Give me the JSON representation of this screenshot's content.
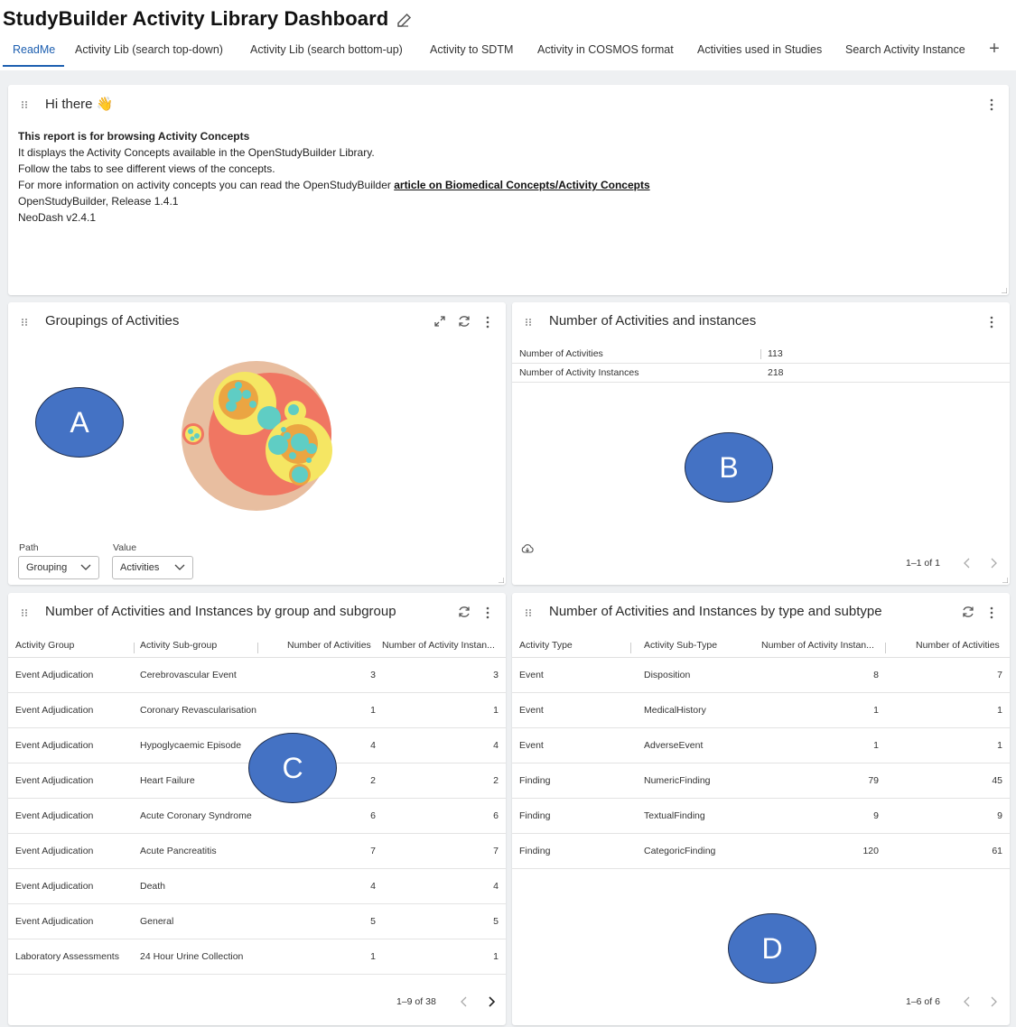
{
  "app": {
    "title": "StudyBuilder Activity Library Dashboard",
    "edit_icon": "pencil-edit-icon"
  },
  "tabs": [
    {
      "label": "ReadMe",
      "active": true
    },
    {
      "label": "Activity Lib (search top-down)"
    },
    {
      "label": "Activity Lib (search bottom-up)"
    },
    {
      "label": "Activity to SDTM"
    },
    {
      "label": "Activity in COSMOS format"
    },
    {
      "label": "Activities used in Studies"
    },
    {
      "label": "Search Activity Instance"
    }
  ],
  "tab_add_icon": "plus-icon",
  "readme": {
    "title": "Hi there",
    "emoji": "👋",
    "heading": "This report is for browsing Activity Concepts",
    "line1": "It displays the Activity Concepts available in the OpenStudyBuilder Library.",
    "line2": "Follow the tabs to see different views of the concepts.",
    "line3_prefix": "For more information on activity concepts you can read the OpenStudyBuilder ",
    "line3_link": "article on Biomedical Concepts/Activity Concepts",
    "line4": "OpenStudyBuilder, Release 1.4.1",
    "line5": "NeoDash v2.4.1"
  },
  "groupings": {
    "title": "Groupings of Activities",
    "path_label": "Path",
    "path_value": "Grouping",
    "value_label": "Value",
    "value_value": "Activities",
    "colors": {
      "outer": "#e8bea0",
      "group": "#f07662",
      "subgroup": "#f5e663",
      "leaf": "#5fcdc4",
      "ring": "#eba542"
    }
  },
  "counts": {
    "title": "Number of Activities and instances",
    "rows": [
      {
        "label": "Number of Activities",
        "value": "113"
      },
      {
        "label": "Number of Activity Instances",
        "value": "218"
      }
    ],
    "download_icon": "cloud-download-icon",
    "pagination": "1–1 of 1"
  },
  "by_group": {
    "title": "Number of Activities and Instances by group and subgroup",
    "columns": [
      "Activity Group",
      "Activity Sub-group",
      "Number of Activities",
      "Number of Activity Instan..."
    ],
    "rows": [
      [
        "Event Adjudication",
        "Cerebrovascular Event",
        "3",
        "3"
      ],
      [
        "Event Adjudication",
        "Coronary Revascularisation",
        "1",
        "1"
      ],
      [
        "Event Adjudication",
        "Hypoglycaemic Episode",
        "4",
        "4"
      ],
      [
        "Event Adjudication",
        "Heart Failure",
        "2",
        "2"
      ],
      [
        "Event Adjudication",
        "Acute Coronary Syndrome",
        "6",
        "6"
      ],
      [
        "Event Adjudication",
        "Acute Pancreatitis",
        "7",
        "7"
      ],
      [
        "Event Adjudication",
        "Death",
        "4",
        "4"
      ],
      [
        "Event Adjudication",
        "General",
        "5",
        "5"
      ],
      [
        "Laboratory Assessments",
        "24 Hour Urine Collection",
        "1",
        "1"
      ]
    ],
    "pagination": "1–9 of 38"
  },
  "by_type": {
    "title": "Number of Activities and Instances by type and subtype",
    "columns": [
      "Activity Type",
      "Activity Sub-Type",
      "Number of Activity Instan...",
      "Number of Activities"
    ],
    "rows": [
      [
        "Event",
        "Disposition",
        "8",
        "7"
      ],
      [
        "Event",
        "MedicalHistory",
        "1",
        "1"
      ],
      [
        "Event",
        "AdverseEvent",
        "1",
        "1"
      ],
      [
        "Finding",
        "NumericFinding",
        "79",
        "45"
      ],
      [
        "Finding",
        "TextualFinding",
        "9",
        "9"
      ],
      [
        "Finding",
        "CategoricFinding",
        "120",
        "61"
      ]
    ],
    "pagination": "1–6 of 6"
  },
  "markers": {
    "a": "A",
    "b": "B",
    "c": "C",
    "d": "D"
  }
}
